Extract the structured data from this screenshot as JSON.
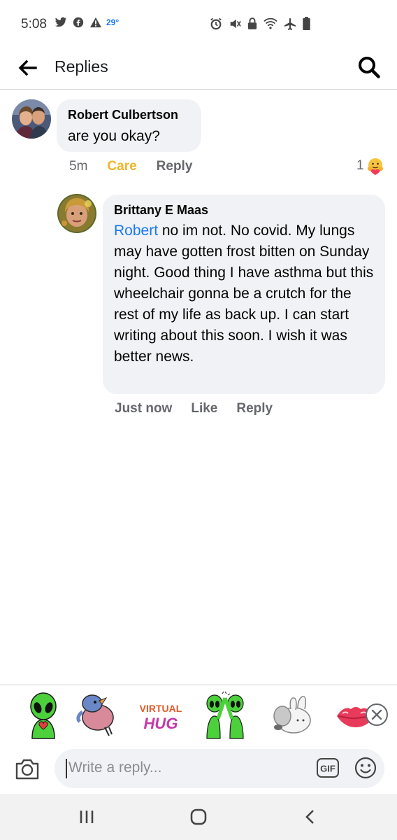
{
  "status_bar": {
    "time": "5:08",
    "temperature": "29°",
    "left_icons": [
      "twitter-icon",
      "facebook-icon",
      "warning-icon"
    ],
    "right_icons": [
      "alarm-icon",
      "mute-icon",
      "lock-icon",
      "wifi-icon",
      "airplane-icon",
      "battery-icon"
    ]
  },
  "header": {
    "title": "Replies",
    "back_icon": "arrow-left-icon",
    "search_icon": "search-icon"
  },
  "comments": [
    {
      "author": "Robert Culbertson",
      "text": "are you okay?",
      "time": "5m",
      "reaction_label": "Care",
      "reply_label": "Reply",
      "reaction_count": "1",
      "reaction_icon": "care-emoji-icon"
    },
    {
      "author": "Brittany E Maas",
      "mention": "Robert",
      "text": " no im not. No covid. My lungs may have gotten frost bitten on Sunday night. Good thing I have asthma but this wheelchair gonna be a crutch for the rest of my life as back up. I can start writing about this soon. I wish it was better news.",
      "time": "Just now",
      "like_label": "Like",
      "reply_label": "Reply"
    }
  ],
  "stickers": [
    {
      "name": "alien-heart-sticker"
    },
    {
      "name": "bird-sticker"
    },
    {
      "name": "virtual-hug-sticker",
      "text_line1": "VIRTUAL",
      "text_line2": "HUG"
    },
    {
      "name": "alien-high-five-sticker"
    },
    {
      "name": "bunny-hug-sticker"
    },
    {
      "name": "kiss-lips-sticker"
    }
  ],
  "composer": {
    "placeholder": "Write a reply...",
    "gif_label": "GIF",
    "camera_icon": "camera-icon",
    "emoji_icon": "emoji-icon"
  },
  "nav": {
    "items": [
      "recents-icon",
      "home-icon",
      "back-icon"
    ]
  },
  "colors": {
    "accent_blue": "#1877f2",
    "care_yellow": "#f0b429",
    "bubble_gray": "#f0f2f5",
    "muted_text": "#65676b"
  }
}
